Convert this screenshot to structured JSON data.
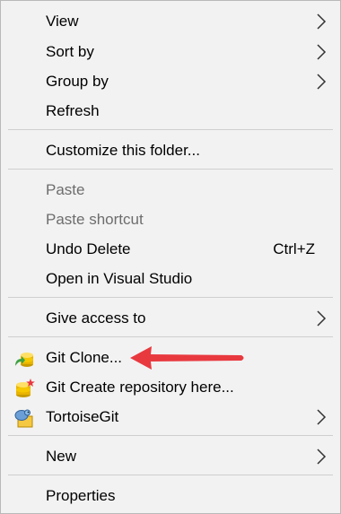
{
  "menu": {
    "items": [
      {
        "label": "View",
        "submenu": true
      },
      {
        "label": "Sort by",
        "submenu": true
      },
      {
        "label": "Group by",
        "submenu": true
      },
      {
        "label": "Refresh"
      },
      {
        "label": "Customize this folder..."
      },
      {
        "label": "Paste",
        "disabled": true
      },
      {
        "label": "Paste shortcut",
        "disabled": true
      },
      {
        "label": "Undo Delete",
        "shortcut": "Ctrl+Z"
      },
      {
        "label": "Open in Visual Studio"
      },
      {
        "label": "Give access to",
        "submenu": true
      },
      {
        "label": "Git Clone...",
        "icon": "git-clone-icon"
      },
      {
        "label": "Git Create repository here...",
        "icon": "git-create-repo-icon"
      },
      {
        "label": "TortoiseGit",
        "icon": "tortoisegit-icon",
        "submenu": true
      },
      {
        "label": "New",
        "submenu": true
      },
      {
        "label": "Properties"
      }
    ]
  },
  "colors": {
    "menu_background": "#f2f2f2",
    "disabled_text": "#6d6d6d",
    "annotation_arrow": "#e8393f"
  }
}
